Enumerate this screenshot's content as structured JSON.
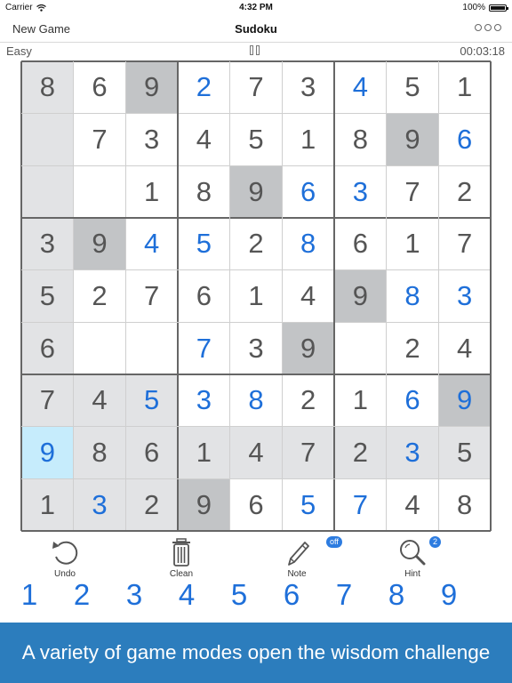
{
  "status_bar": {
    "carrier": "Carrier",
    "time": "4:32 PM",
    "battery": "100%"
  },
  "nav": {
    "new_game": "New Game",
    "title": "Sudoku"
  },
  "info": {
    "level": "Easy",
    "timer": "00:03:18"
  },
  "board": {
    "rows": [
      [
        "8",
        "6",
        "9",
        "2",
        "7",
        "3",
        "4",
        "5",
        "1"
      ],
      [
        "",
        "7",
        "3",
        "4",
        "5",
        "1",
        "8",
        "9",
        "6"
      ],
      [
        "",
        "",
        "1",
        "8",
        "9",
        "6",
        "3",
        "7",
        "2"
      ],
      [
        "3",
        "9",
        "4",
        "5",
        "2",
        "8",
        "6",
        "1",
        "7"
      ],
      [
        "5",
        "2",
        "7",
        "6",
        "1",
        "4",
        "9",
        "8",
        "3"
      ],
      [
        "6",
        "",
        "",
        "7",
        "3",
        "9",
        "",
        "2",
        "4"
      ],
      [
        "7",
        "4",
        "5",
        "3",
        "8",
        "2",
        "1",
        "6",
        "9"
      ],
      [
        "9",
        "8",
        "6",
        "1",
        "4",
        "7",
        "2",
        "3",
        "5"
      ],
      [
        "1",
        "3",
        "2",
        "9",
        "6",
        "5",
        "7",
        "4",
        "8"
      ]
    ],
    "blue_cells": [
      [
        0,
        3
      ],
      [
        0,
        6
      ],
      [
        1,
        8
      ],
      [
        2,
        5
      ],
      [
        2,
        6
      ],
      [
        3,
        2
      ],
      [
        3,
        3
      ],
      [
        3,
        5
      ],
      [
        4,
        7
      ],
      [
        4,
        8
      ],
      [
        5,
        3
      ],
      [
        6,
        2
      ],
      [
        6,
        3
      ],
      [
        6,
        4
      ],
      [
        6,
        7
      ],
      [
        6,
        8
      ],
      [
        7,
        0
      ],
      [
        7,
        7
      ],
      [
        8,
        1
      ],
      [
        8,
        5
      ],
      [
        8,
        6
      ]
    ],
    "dark_cells": [
      [
        0,
        2
      ],
      [
        1,
        7
      ],
      [
        2,
        4
      ],
      [
        3,
        1
      ],
      [
        4,
        6
      ],
      [
        5,
        5
      ],
      [
        6,
        8
      ],
      [
        8,
        3
      ]
    ],
    "light_cells": [
      [
        0,
        0
      ],
      [
        1,
        0
      ],
      [
        2,
        0
      ],
      [
        3,
        0
      ],
      [
        4,
        0
      ],
      [
        5,
        0
      ],
      [
        6,
        0
      ],
      [
        8,
        0
      ],
      [
        6,
        1
      ],
      [
        6,
        2
      ],
      [
        7,
        1
      ],
      [
        7,
        2
      ],
      [
        8,
        1
      ],
      [
        8,
        2
      ],
      [
        7,
        3
      ],
      [
        7,
        4
      ],
      [
        7,
        5
      ],
      [
        7,
        6
      ],
      [
        7,
        7
      ],
      [
        7,
        8
      ]
    ],
    "selected_cell": [
      7,
      0
    ],
    "colors": {
      "dark": "#c2c4c6",
      "light": "#e2e3e5",
      "selected": "#c6ecfc",
      "blue_digit": "#1e6fd9",
      "grey_digit": "#555555"
    }
  },
  "tools": {
    "undo": "Undo",
    "clean": "Clean",
    "note": "Note",
    "note_badge": "off",
    "hint": "Hint",
    "hint_badge": "2"
  },
  "numpad": [
    "1",
    "2",
    "3",
    "4",
    "5",
    "6",
    "7",
    "8",
    "9"
  ],
  "banner": "A variety of game modes open the wisdom challenge",
  "icons": {
    "undo": "undo-icon",
    "clean": "trash-icon",
    "note": "pencil-icon",
    "hint": "magnifier-icon"
  }
}
